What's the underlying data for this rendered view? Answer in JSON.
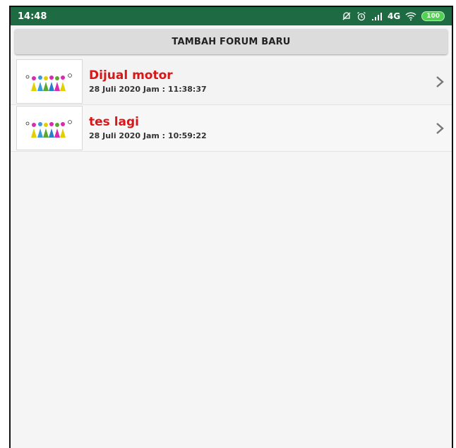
{
  "statusbar": {
    "time": "14:48",
    "network": "4G",
    "battery": "100",
    "icons": [
      "bell-off-icon",
      "alarm-icon",
      "signal-icon",
      "wifi-icon",
      "battery-icon"
    ]
  },
  "toolbar": {
    "add_forum_label": "TAMBAH FORUM BARU"
  },
  "forums": [
    {
      "title": "Dijual motor",
      "date": "28 Juli 2020 Jam : 11:38:37"
    },
    {
      "title": "tes lagi",
      "date": "28 Juli 2020 Jam : 10:59:22"
    }
  ],
  "colors": {
    "statusbar": "#1e6b43",
    "title": "#d81818",
    "button": "#dcdcdc",
    "battery": "#52d152"
  }
}
